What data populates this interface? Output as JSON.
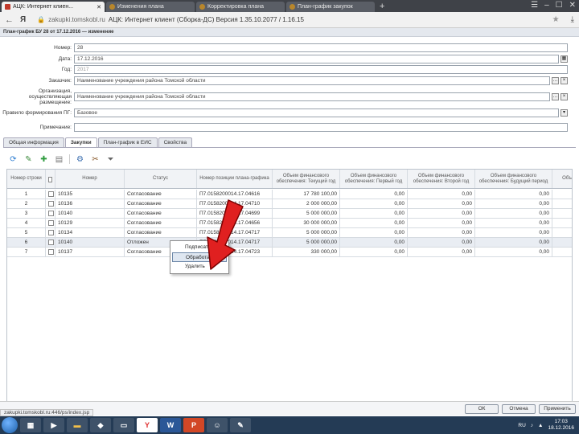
{
  "browser": {
    "tabs": [
      {
        "label": "АЦК: Интернет клиен..."
      },
      {
        "label": "Изменения плана"
      },
      {
        "label": "Корректировка плана"
      },
      {
        "label": "План-график закупок"
      }
    ],
    "new_tab": "+",
    "back": "←",
    "browser_logo": "Я",
    "url_host": "zakupki.tomskobl.ru",
    "url_title": "АЦК: Интернет клиент (Сборка-ДС)   Версия 1.35.10.2077 / 1.16.15",
    "status_url": "zakupki.tomskobl.ru:446/ps/index.jsp"
  },
  "document": {
    "title": "План-график БУ 28 от 17.12.2016 — изменение"
  },
  "form": {
    "number_label": "Номер:",
    "number_value": "28",
    "date_label": "Дата:",
    "date_value": "17.12.2016",
    "year_label": "Год:",
    "year_value": "2017",
    "customer_label": "Заказчик:",
    "customer_value": "Наименование учреждения района Томской области",
    "org_label": "Организация, осуществляющая размещение:",
    "org_value": "Наименование учреждения района Томской области",
    "rule_label": "Правило формирования ПГ:",
    "rule_value": "Базовое",
    "note_label": "Примечание:",
    "note_value": ""
  },
  "tabs": [
    {
      "label": "Общая информация"
    },
    {
      "label": "Закупки"
    },
    {
      "label": "План-график в ЕИС"
    },
    {
      "label": "Свойства"
    }
  ],
  "grid": {
    "columns": [
      "Номер строки",
      "",
      "Номер",
      "Статус",
      "Номер позиции плана-графика",
      "Объем финансового обеспечения: Текущий год",
      "Объем финансового обеспечения: Первый год",
      "Объем финансового обеспечения: Второй год",
      "Объем финансового обеспечения: Будущий период",
      "Объ..."
    ],
    "rows": [
      {
        "line": "1",
        "num": "10135",
        "status": "Согласование",
        "pos": "П7.0158200014.17.04616",
        "cur": "17 780 100,00",
        "y1": "0,00",
        "y2": "0,00",
        "fut": "0,00"
      },
      {
        "line": "2",
        "num": "10136",
        "status": "Согласование",
        "pos": "П7.0158200014.17.04710",
        "cur": "2 000 000,00",
        "y1": "0,00",
        "y2": "0,00",
        "fut": "0,00"
      },
      {
        "line": "3",
        "num": "10140",
        "status": "Согласование",
        "pos": "П7.0158200014.17.04699",
        "cur": "5 000 000,00",
        "y1": "0,00",
        "y2": "0,00",
        "fut": "0,00"
      },
      {
        "line": "4",
        "num": "10129",
        "status": "Согласование",
        "pos": "П7.0158200014.17.04656",
        "cur": "30 000 000,00",
        "y1": "0,00",
        "y2": "0,00",
        "fut": "0,00"
      },
      {
        "line": "5",
        "num": "10134",
        "status": "Согласование",
        "pos": "П7.0158200014.17.04717",
        "cur": "5 000 000,00",
        "y1": "0,00",
        "y2": "0,00",
        "fut": "0,00"
      },
      {
        "line": "6",
        "num": "10140",
        "status": "Отложен",
        "pos": "П7.0158200014.17.04717",
        "cur": "5 000 000,00",
        "y1": "0,00",
        "y2": "0,00",
        "fut": "0,00"
      },
      {
        "line": "7",
        "num": "10137",
        "status": "Согласование",
        "pos": "П7.0158200014.17.04723",
        "cur": "330 000,00",
        "y1": "0,00",
        "y2": "0,00",
        "fut": "0,00"
      }
    ]
  },
  "context_menu": {
    "items": [
      {
        "label": "Подписать"
      },
      {
        "label": "Обработать"
      },
      {
        "label": "Удалить"
      }
    ]
  },
  "footer": {
    "ok": "ОК",
    "cancel": "Отмена",
    "apply": "Применить"
  },
  "taskbar": {
    "tray_lang": "RU",
    "time": "17:03",
    "date": "18.12.2016"
  },
  "colors": {
    "annotation_arrow": "#e02020",
    "taskbar": "#243b55"
  }
}
